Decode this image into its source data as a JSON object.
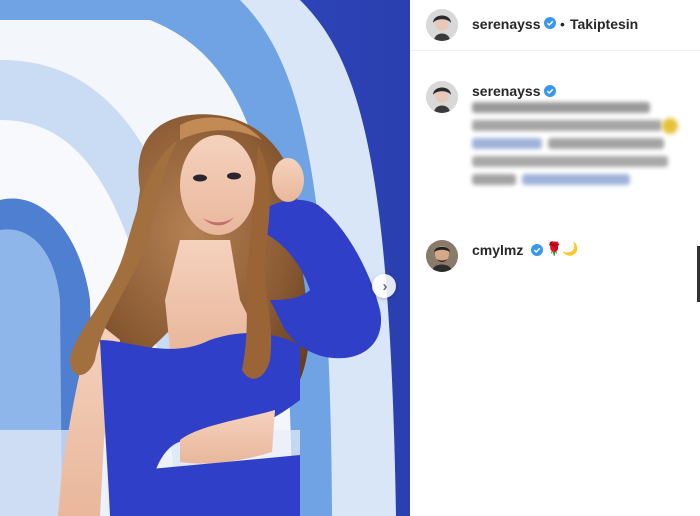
{
  "post": {
    "author": "serenayss",
    "follow_status": "Takiptesin",
    "separator": "•"
  },
  "caption": {
    "author": "serenayss"
  },
  "comment": {
    "author": "cmylmz",
    "emojis": "🌹🌙"
  },
  "colors": {
    "verified": "#3897f0",
    "dress": "#2f3fc7",
    "background_blue": "#3d56c4"
  },
  "icons": {
    "next": "chevron-right-icon",
    "verified": "verified-badge-icon"
  }
}
